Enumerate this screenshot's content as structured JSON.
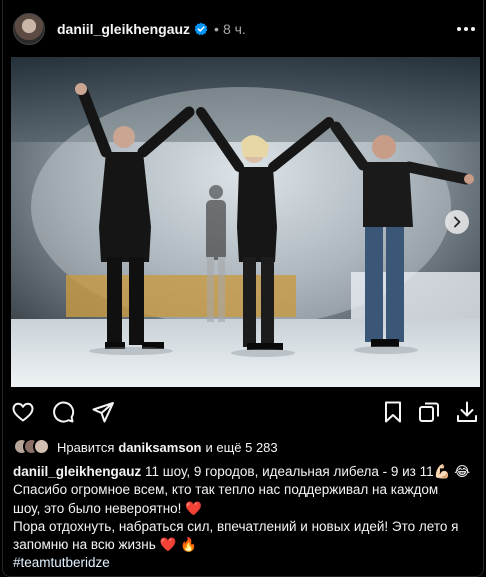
{
  "post": {
    "username": "daniil_gleikhengauz",
    "separator": "•",
    "time": "8 ч."
  },
  "actions": {
    "like_icon": "heart-icon",
    "comment_icon": "comment-icon",
    "share_icon": "send-icon",
    "save_icon": "bookmark-icon",
    "carousel_icon": "carousel-icon",
    "download_icon": "download-icon"
  },
  "likes": {
    "prefix": "Нравится",
    "user": "daniksamson",
    "suffix": "и ещё 5 283"
  },
  "caption": {
    "username": "daniil_gleikhengauz",
    "line1": "11 шоу, 9 городов, идеальная либела - 9 из 11💪🏻 😂",
    "line2": "Спасибо огромное всем, кто так тепло нас поддерживал на каждом",
    "line3": "шоу, это было невероятно! ❤️",
    "line4": "Пора отдохнуть, набраться сил, впечатлений и новых идей! Это лето я",
    "line5": "запомню на всю жизнь ❤️ 🔥",
    "hashtag": "#teamtutberidze"
  },
  "colors": {
    "background": "#000000",
    "text": "#f5f5f5",
    "muted": "#a8a8a8",
    "verified": "#0095f6",
    "hashtag": "#e0f1ff"
  }
}
